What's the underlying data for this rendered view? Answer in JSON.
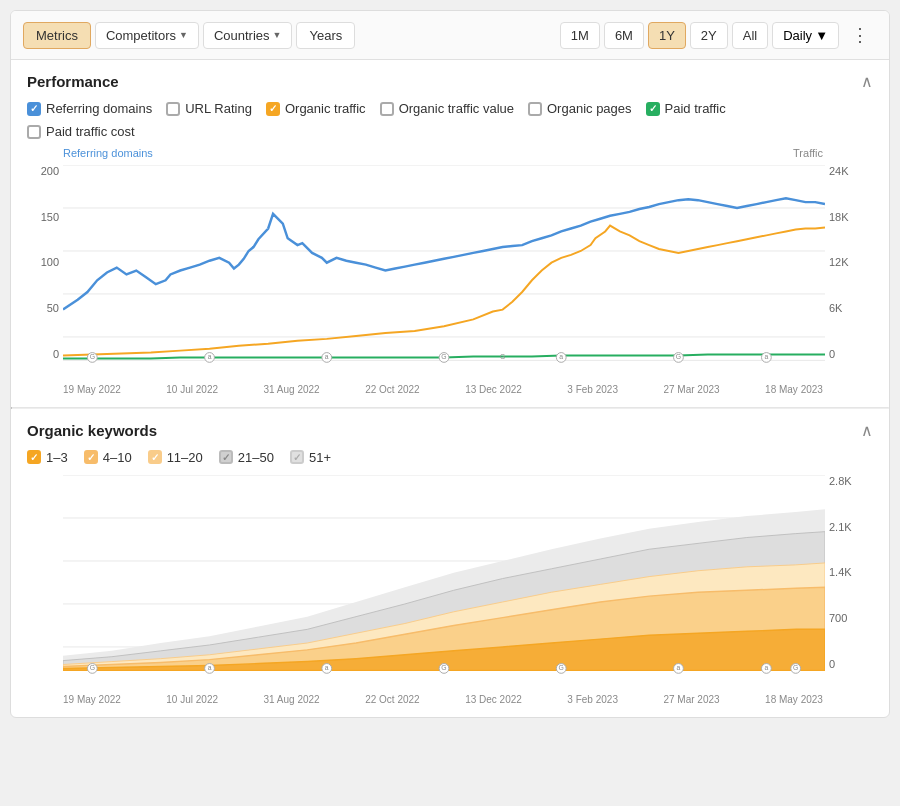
{
  "nav": {
    "metrics_label": "Metrics",
    "competitors_label": "Competitors",
    "countries_label": "Countries",
    "years_label": "Years",
    "time_buttons": [
      "1M",
      "6M",
      "1Y",
      "2Y",
      "All"
    ],
    "active_time": "1Y",
    "granularity_label": "Daily",
    "more_icon": "⋮"
  },
  "performance": {
    "title": "Performance",
    "metrics": [
      {
        "id": "referring-domains",
        "label": "Referring domains",
        "state": "checked-blue"
      },
      {
        "id": "url-rating",
        "label": "URL Rating",
        "state": "unchecked"
      },
      {
        "id": "organic-traffic",
        "label": "Organic traffic",
        "state": "checked-orange"
      },
      {
        "id": "organic-traffic-value",
        "label": "Organic traffic value",
        "state": "unchecked"
      },
      {
        "id": "organic-pages",
        "label": "Organic pages",
        "state": "unchecked"
      },
      {
        "id": "paid-traffic",
        "label": "Paid traffic",
        "state": "checked-green"
      }
    ],
    "metrics2": [
      {
        "id": "paid-traffic-cost",
        "label": "Paid traffic cost",
        "state": "unchecked"
      }
    ],
    "left_axis_title": "Referring domains",
    "right_axis_title": "Traffic",
    "left_y_labels": [
      "200",
      "150",
      "100",
      "50",
      "0"
    ],
    "right_y_labels": [
      "24K",
      "18K",
      "12K",
      "6K",
      "0"
    ],
    "x_labels": [
      "19 May 2022",
      "10 Jul 2022",
      "31 Aug 2022",
      "22 Oct 2022",
      "13 Dec 2022",
      "3 Feb 2023",
      "27 Mar 2023",
      "18 May 2023"
    ]
  },
  "organic_keywords": {
    "title": "Organic keywords",
    "legend": [
      {
        "label": "1–3",
        "color": "#f5a623"
      },
      {
        "label": "4–10",
        "color": "#f7bc6a"
      },
      {
        "label": "11–20",
        "color": "#f9cc8a"
      },
      {
        "label": "21–50",
        "color": "#d0d0d0"
      },
      {
        "label": "51+",
        "color": "#e0e0e0"
      }
    ],
    "right_y_labels": [
      "2.8K",
      "2.1K",
      "1.4K",
      "700",
      "0"
    ],
    "x_labels": [
      "19 May 2022",
      "10 Jul 2022",
      "31 Aug 2022",
      "22 Oct 2022",
      "13 Dec 2022",
      "3 Feb 2023",
      "27 Mar 2023",
      "18 May 2023"
    ]
  }
}
